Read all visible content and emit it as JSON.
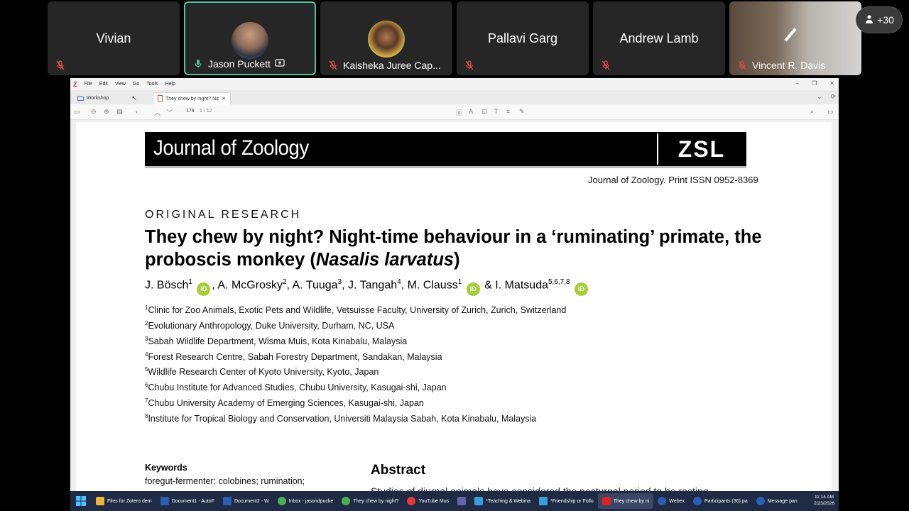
{
  "participants": [
    {
      "name": "Vivian",
      "caption": "",
      "mic": "muted"
    },
    {
      "name": "",
      "caption": "Jason Puckett",
      "mic": "active"
    },
    {
      "name": "",
      "caption": "Kaisheka Juree Cap...",
      "mic": "muted"
    },
    {
      "name": "Pallavi Garg",
      "caption": "",
      "mic": "muted"
    },
    {
      "name": "Andrew Lamb",
      "caption": "",
      "mic": "muted"
    },
    {
      "name": "",
      "caption": "Vincent R. Davis",
      "mic": "muted"
    }
  ],
  "more_participants": "+30",
  "app": {
    "menu": [
      "File",
      "Edit",
      "View",
      "Go",
      "Tools",
      "Help"
    ],
    "tabs": {
      "library": "Workshop",
      "document": "They chew by night? Night"
    },
    "page_number": "179",
    "page_count": "1 / 12"
  },
  "paper": {
    "journal": "Journal of Zoology",
    "publisher_logo": "ZSL",
    "issn": "Journal of Zoology. Print ISSN 0952-8369",
    "section": "ORIGINAL RESEARCH",
    "title_part1": "They chew by night? Night-time behaviour in a ‘ruminating’ primate, the proboscis monkey (",
    "title_italic": "Nasalis larvatus",
    "title_part2": ")",
    "authors": [
      {
        "name": "J. Bösch",
        "sup": "1",
        "orcid": true,
        "sep": ", "
      },
      {
        "name": "A. McGrosky",
        "sup": "2",
        "orcid": false,
        "sep": ", "
      },
      {
        "name": "A. Tuuga",
        "sup": "3",
        "orcid": false,
        "sep": ", "
      },
      {
        "name": "J. Tangah",
        "sup": "4",
        "orcid": false,
        "sep": ", "
      },
      {
        "name": "M. Clauss",
        "sup": "1",
        "orcid": true,
        "sep": " & "
      },
      {
        "name": "I. Matsuda",
        "sup": "5,6,7,8",
        "orcid": true,
        "sep": ""
      }
    ],
    "affiliations": [
      {
        "n": "1",
        "text": "Clinic for Zoo Animals, Exotic Pets and Wildlife, Vetsuisse Faculty, University of Zurich, Zurich, Switzerland"
      },
      {
        "n": "2",
        "text": "Evolutionary Anthropology, Duke University, Durham, NC, USA"
      },
      {
        "n": "3",
        "text": "Sabah Wildlife Department, Wisma Muis, Kota Kinabalu, Malaysia"
      },
      {
        "n": "4",
        "text": "Forest Research Centre, Sabah Forestry Department, Sandakan, Malaysia"
      },
      {
        "n": "5",
        "text": "Wildlife Research Center of Kyoto University, Kyoto, Japan"
      },
      {
        "n": "6",
        "text": "Chubu Institute for Advanced Studies, Chubu University, Kasugai-shi, Japan"
      },
      {
        "n": "7",
        "text": "Chubu University Academy of Emerging Sciences, Kasugai-shi, Japan"
      },
      {
        "n": "8",
        "text": "Institute for Tropical Biology and Conservation, Universiti Malaysia Sabah, Kota Kinabalu, Malaysia"
      }
    ],
    "keywords_heading": "Keywords",
    "keywords": "foregut-fermenter; colobines; rumination;",
    "abstract_heading": "Abstract",
    "abstract_start": "Studies of diurnal animals have considered the nocturnal period to be resting"
  },
  "taskbar": {
    "items": [
      {
        "label": "Files for Zotero dem",
        "color": "#e8b43a"
      },
      {
        "label": "Document1 - AutoF",
        "color": "#2b5fb4"
      },
      {
        "label": "Document2 - W",
        "color": "#2b5fb4"
      },
      {
        "label": "Inbox - jasondpucke",
        "color": "#4caf50"
      },
      {
        "label": "They chew by night?",
        "color": "#4caf50"
      },
      {
        "label": "YouTube Mus",
        "color": "#e53935"
      },
      {
        "label": "",
        "color": "#6264a7"
      },
      {
        "label": "*Teaching & Webina",
        "color": "#3aa0d8"
      },
      {
        "label": "*Friendship or Follo",
        "color": "#3aa0d8"
      },
      {
        "label": "They chew by ni",
        "color": "#d22"
      },
      {
        "label": "Webex",
        "color": "#2b5fb4"
      },
      {
        "label": "Participants (36) pa",
        "color": "#2b5fb4"
      },
      {
        "label": "Message pan",
        "color": "#2b5fb4"
      }
    ],
    "time": "11:14 AM",
    "date": "2/23/2026"
  }
}
